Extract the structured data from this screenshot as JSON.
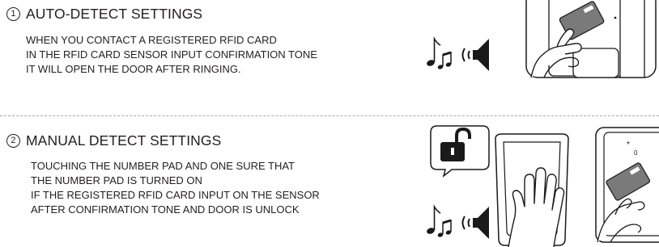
{
  "steps": [
    {
      "number": "1",
      "title": "AUTO-DETECT SETTINGS",
      "lines": [
        "WHEN YOU CONTACT A REGISTERED RFID CARD",
        "IN THE RFID CARD SENSOR INPUT CONFIRMATION TONE",
        "IT WILL OPEN THE DOOR AFTER RINGING."
      ]
    },
    {
      "number": "2",
      "title": "MANUAL DETECT SETTINGS",
      "lines": [
        "TOUCHING THE NUMBER PAD AND ONE SURE THAT",
        "THE NUMBER PAD IS TURNED ON",
        "IF THE REGISTERED RFID CARD INPUT ON THE SENSOR",
        "AFTER CONFIRMATION TONE AND DOOR IS UNLOCK"
      ]
    }
  ],
  "icons": {
    "sound": "music-note-speaker-icon",
    "unlock": "unlocked-padlock-icon",
    "hand": "hand-on-keypad-icon",
    "card": "rfid-card-in-hand-icon"
  },
  "colors": {
    "text": "#231f20",
    "divider": "#a8a8a8",
    "illustration_stroke": "#1a1a1a",
    "device_gray": "#7a7a7a"
  }
}
